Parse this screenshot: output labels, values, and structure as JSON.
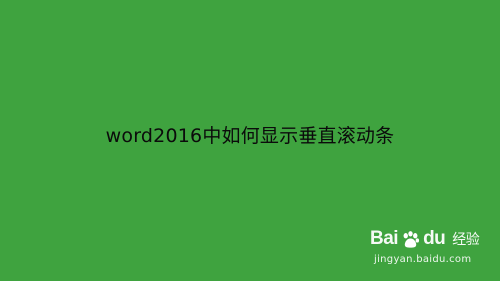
{
  "title": "word2016中如何显示垂直滚动条",
  "watermark": {
    "brand_bai": "Bai",
    "brand_du": "du",
    "brand_jingyan": "经验",
    "url": "jingyan.baidu.com"
  },
  "colors": {
    "background": "#3fa33f",
    "title_text": "#0b0b0b",
    "watermark": "#ffffff"
  }
}
